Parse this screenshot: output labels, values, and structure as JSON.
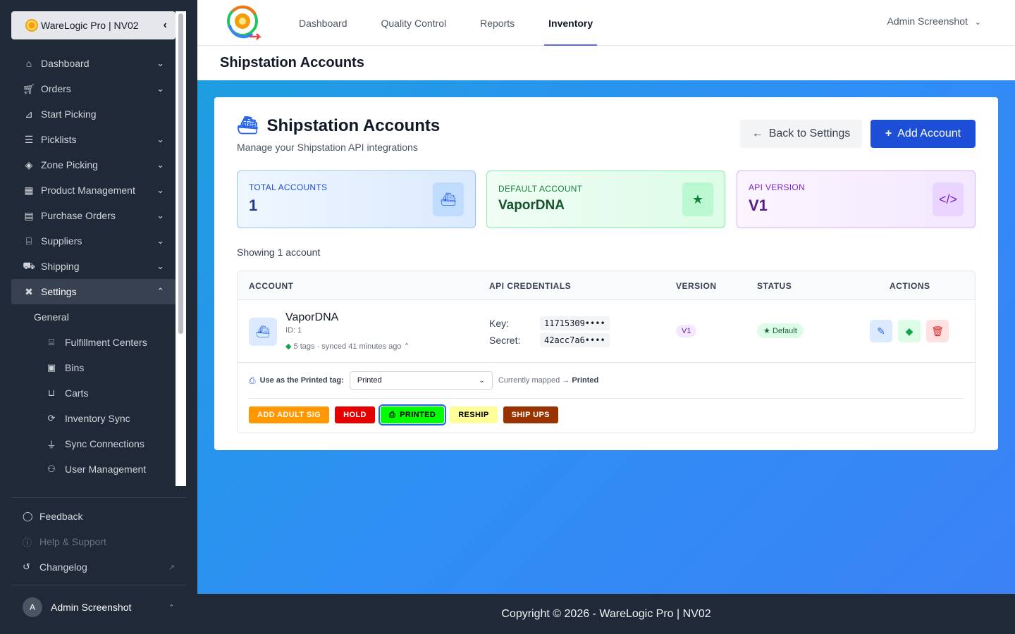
{
  "sidebar": {
    "brand": "WareLogic Pro | NV02",
    "items": [
      {
        "label": "Dashboard",
        "icon": "home-icon"
      },
      {
        "label": "Orders",
        "icon": "cart-icon"
      },
      {
        "label": "Start Picking",
        "icon": "dolly-icon"
      },
      {
        "label": "Picklists",
        "icon": "list-icon"
      },
      {
        "label": "Zone Picking",
        "icon": "layers-icon"
      },
      {
        "label": "Product Management",
        "icon": "boxes-icon"
      },
      {
        "label": "Purchase Orders",
        "icon": "file-invoice-icon"
      },
      {
        "label": "Suppliers",
        "icon": "warehouse-icon"
      },
      {
        "label": "Shipping",
        "icon": "truck-icon"
      },
      {
        "label": "Settings",
        "icon": "tools-icon"
      }
    ],
    "settings_group": "General",
    "settings_sub": [
      {
        "label": "Fulfillment Centers",
        "icon": "warehouse-icon"
      },
      {
        "label": "Bins",
        "icon": "box-open-icon"
      },
      {
        "label": "Carts",
        "icon": "dolly-flatbed-icon"
      },
      {
        "label": "Inventory Sync",
        "icon": "sync-icon"
      },
      {
        "label": "Sync Connections",
        "icon": "plug-icon"
      },
      {
        "label": "User Management",
        "icon": "users-icon"
      }
    ],
    "bottom": {
      "feedback": "Feedback",
      "help": "Help & Support",
      "changelog": "Changelog"
    },
    "user": {
      "initial": "A",
      "name": "Admin Screenshot"
    }
  },
  "topnav": {
    "tabs": [
      "Dashboard",
      "Quality Control",
      "Reports",
      "Inventory"
    ],
    "active_tab": "Inventory",
    "user": "Admin Screenshot"
  },
  "page": {
    "title": "Shipstation Accounts"
  },
  "card": {
    "title": "Shipstation Accounts",
    "subtitle": "Manage your Shipstation API integrations",
    "back_label": "Back to Settings",
    "add_label": "Add Account"
  },
  "stats": {
    "total": {
      "label": "TOTAL ACCOUNTS",
      "value": "1"
    },
    "default": {
      "label": "DEFAULT ACCOUNT",
      "value": "VaporDNA"
    },
    "api": {
      "label": "API VERSION",
      "value": "V1"
    }
  },
  "showing": "Showing 1 account",
  "table": {
    "headers": [
      "ACCOUNT",
      "API CREDENTIALS",
      "VERSION",
      "STATUS",
      "ACTIONS"
    ],
    "row": {
      "name": "VaporDNA",
      "id": "ID: 1",
      "tags": "5 tags",
      "synced": "synced 41 minutes ago",
      "key_label": "Key:",
      "key_value": "11715309••••",
      "secret_label": "Secret:",
      "secret_value": "42acc7a6••••",
      "version": "V1",
      "status": "Default"
    }
  },
  "tag_mapping": {
    "label": "Use as the Printed tag:",
    "selected": "Printed",
    "mapped_prefix": "Currently mapped →",
    "mapped_value": "Printed"
  },
  "tags": [
    {
      "label": "ADD ADULT SIG",
      "bg": "#ff9800",
      "fg": "#ffffff"
    },
    {
      "label": "HOLD",
      "bg": "#e60000",
      "fg": "#ffffff"
    },
    {
      "label": "PRINTED",
      "bg": "#00ff00",
      "fg": "#000000",
      "selected": true
    },
    {
      "label": "RESHIP",
      "bg": "#ffff99",
      "fg": "#000000"
    },
    {
      "label": "SHIP UPS",
      "bg": "#993300",
      "fg": "#ffffff"
    }
  ],
  "footer": "Copyright © 2026 - WareLogic Pro | NV02"
}
